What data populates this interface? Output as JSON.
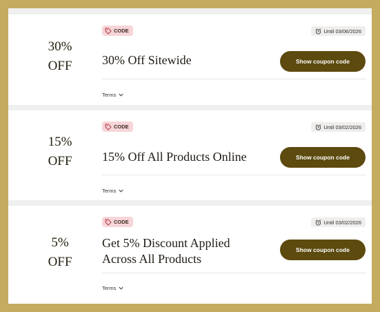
{
  "coupons": [
    {
      "discount_line1": "30%",
      "discount_line2": "OFF",
      "badge": "CODE",
      "until": "Until 03/06/2026",
      "title_line1": "30% Off Sitewide",
      "title_line2": "",
      "button": "Show coupon code",
      "terms": "Terms"
    },
    {
      "discount_line1": "15%",
      "discount_line2": "OFF",
      "badge": "CODE",
      "until": "Until 03/02/2026",
      "title_line1": "15% Off All Products Online",
      "title_line2": "",
      "button": "Show coupon code",
      "terms": "Terms"
    },
    {
      "discount_line1": "5%",
      "discount_line2": "OFF",
      "badge": "CODE",
      "until": "Until 03/02/2026",
      "title_line1": "Get 5% Discount Applied",
      "title_line2": "Across All Products",
      "button": "Show coupon code",
      "terms": "Terms"
    }
  ],
  "colors": {
    "frame": "#c5ab5f",
    "button": "#5c4a0e",
    "badge": "#f7d5d8",
    "until_bg": "#efeeec"
  },
  "icons": [
    "tag-icon",
    "alarm-clock-icon",
    "chevron-down-icon"
  ]
}
